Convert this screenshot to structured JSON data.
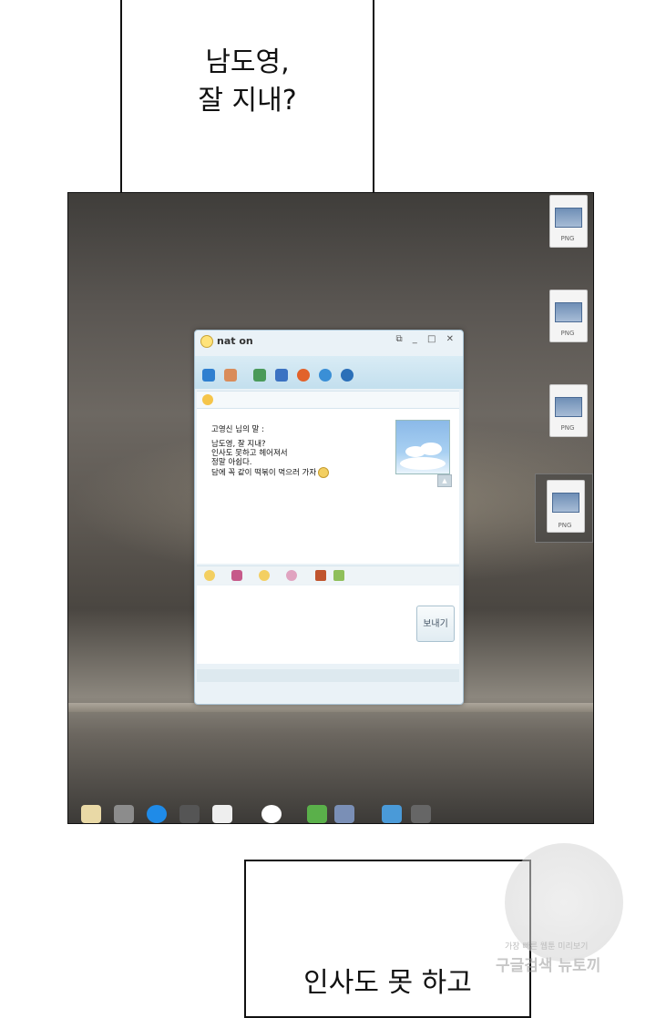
{
  "speech_top": {
    "line1": "남도영,",
    "line2": "잘 지내?"
  },
  "speech_bottom": {
    "text": "인사도 못 하고"
  },
  "desktop": {
    "file_icons": [
      {
        "ext": "PNG"
      },
      {
        "ext": "PNG"
      },
      {
        "ext": "PNG"
      },
      {
        "ext": "PNG"
      }
    ]
  },
  "messenger": {
    "title": "nat on",
    "window_controls": "⧉ _ □ ✕",
    "message": {
      "sender": "고영신 님의 말 :",
      "lines": [
        "남도영, 잘 지내?",
        "인사도 못하고 헤어져서",
        "정말 아쉽다.",
        "담에 꼭 같이 떡볶이 먹으러 가자"
      ]
    },
    "send_label": "보내기"
  },
  "watermark": {
    "line1": "가장 빠른 웹툰 미리보기",
    "line2": "구글검색 뉴토끼"
  }
}
